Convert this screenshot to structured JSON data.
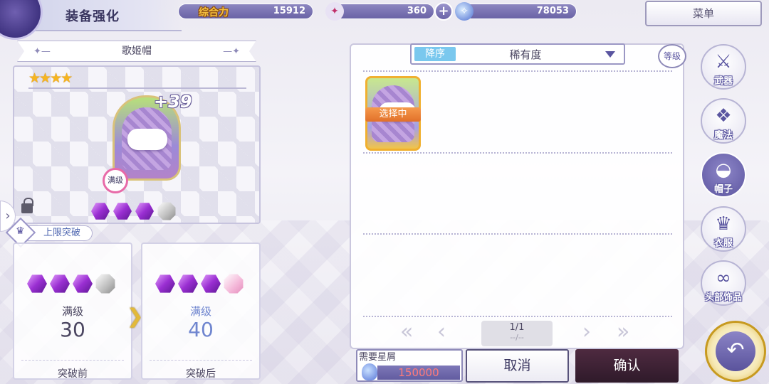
{
  "header": {
    "title": "装备强化",
    "power_label": "综合力",
    "power_value": "15912",
    "stamina_value": "360",
    "plus_label": "+",
    "currency_value": "78053",
    "menu_label": "菜单"
  },
  "item": {
    "name": "歌姬帽",
    "stars": "★★★★",
    "plus_level": "+39",
    "max_label": "满级"
  },
  "limit_break": {
    "title": "上限突破",
    "before": {
      "level_label": "满级",
      "value": "30",
      "footer": "突破前"
    },
    "after": {
      "level_label": "满级",
      "value": "40",
      "footer": "突破后"
    },
    "arrow": "❯"
  },
  "list": {
    "sort_order": "降序",
    "sort_key": "稀有度",
    "level_filter": "等级",
    "selected_tag": "选择中",
    "page": "1/1",
    "page_sub": "--/--",
    "prev_all": "«",
    "prev": "‹",
    "next": "›",
    "next_all": "»"
  },
  "footer": {
    "cost_label": "需要星屑",
    "cost_value": "150000",
    "cancel_label": "取消",
    "confirm_label": "确认"
  },
  "categories": [
    {
      "label": "武器",
      "icon": "crossed-swords-icon",
      "glyph": "⚔"
    },
    {
      "label": "魔法",
      "icon": "magic-cards-icon",
      "glyph": "❖"
    },
    {
      "label": "帽子",
      "icon": "hat-icon",
      "glyph": "◒"
    },
    {
      "label": "衣服",
      "icon": "dress-icon",
      "glyph": "♛"
    },
    {
      "label": "头部饰品",
      "icon": "glasses-icon",
      "glyph": "∞"
    }
  ],
  "nav": {
    "left_arrow": "›",
    "back_glyph": "↶"
  },
  "colors": {
    "accent": "#6a63a6",
    "selected_orange": "#e2702a",
    "confirm_dark": "#2f1a2a",
    "after_blue": "#6f85cf",
    "cost_red": "#ff7a7a"
  }
}
